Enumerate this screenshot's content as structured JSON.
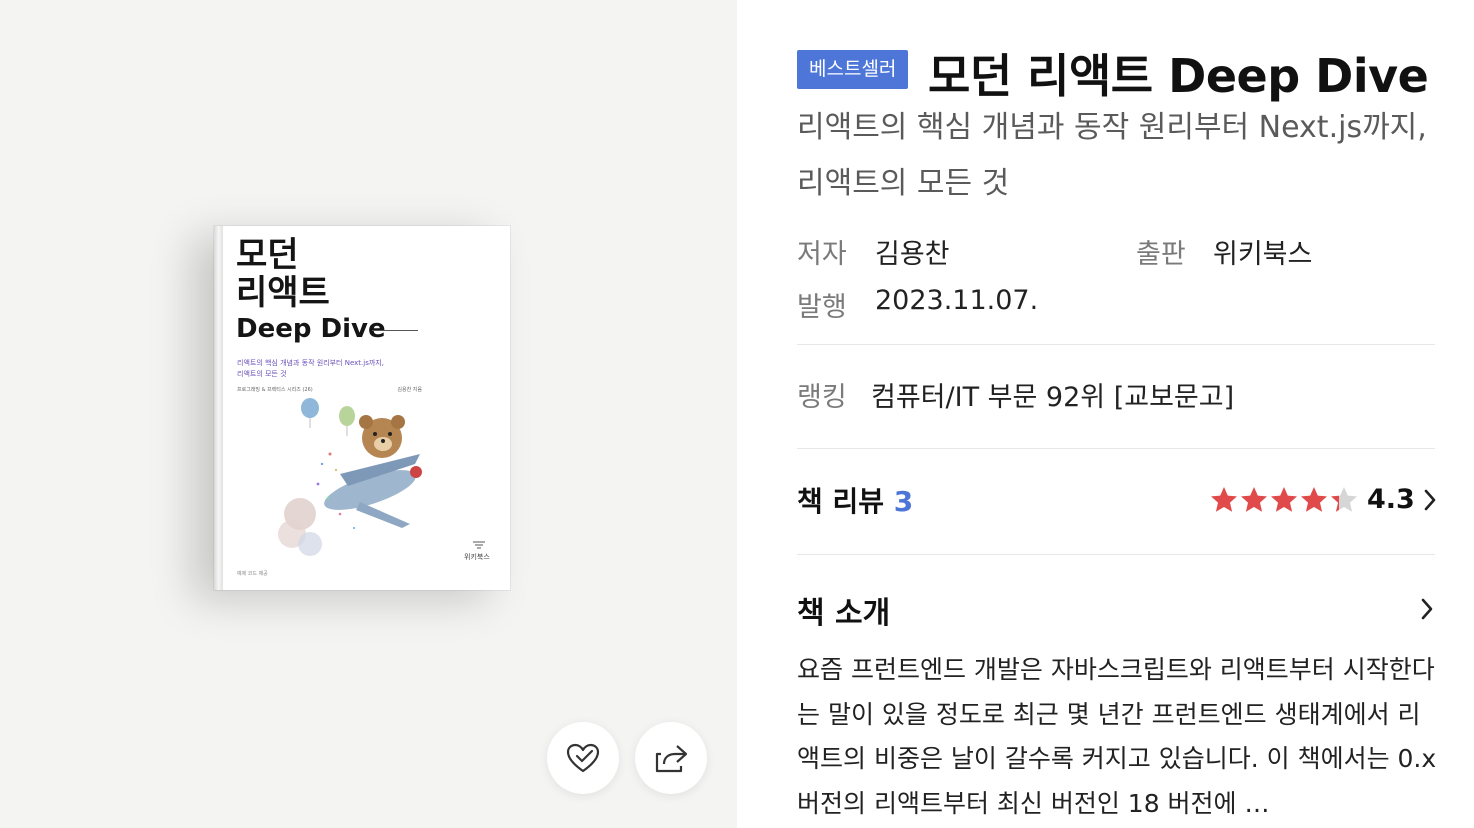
{
  "cover": {
    "title": "모던\n리액트",
    "title_en": "Deep Dive",
    "subtitle": "리액트의 핵심 개념과 동작 원리부터 Next.js까지,\n리액트의 모든 것",
    "series": "프로그래밍 & 프랙티스 시리즈 (26)",
    "author_credit": "김용찬 지음",
    "publisher": "위키북스",
    "footer": "예제 코드 제공"
  },
  "actions": {
    "like_icon": "heart-icon",
    "share_icon": "share-icon"
  },
  "product": {
    "badge": "베스트셀러",
    "title": "모던 리액트 Deep Dive",
    "subtitle": " 리액트의 핵심 개념과 동작 원리부터 Next.js까지, 리액트의 모든 것",
    "author_label": "저자",
    "author": "김용찬",
    "publisher_label": "출판",
    "publisher": "위키북스",
    "date_label": "발행",
    "date": "2023.11.07.",
    "ranking_label": "랭킹",
    "ranking": "컴퓨터/IT 부문 92위 [교보문고]"
  },
  "review": {
    "label": "책 리뷰",
    "count": "3",
    "rating": 4.3,
    "rating_text": "4.3",
    "star_color": "#e04a4a"
  },
  "intro": {
    "label": "책 소개",
    "body": "요즘 프런트엔드 개발은 자바스크립트와 리액트부터 시작한다는 말이 있을 정도로 최근 몇 년간 프런트엔드 생태계에서 리액트의 비중은 날이 갈수록 커지고 있습니다. 이 책에서는 0.x 버전의 리액트부터 최신 버전인 18 버전에 …"
  },
  "colors": {
    "accent": "#4d76d8",
    "star": "#e04a4a"
  }
}
